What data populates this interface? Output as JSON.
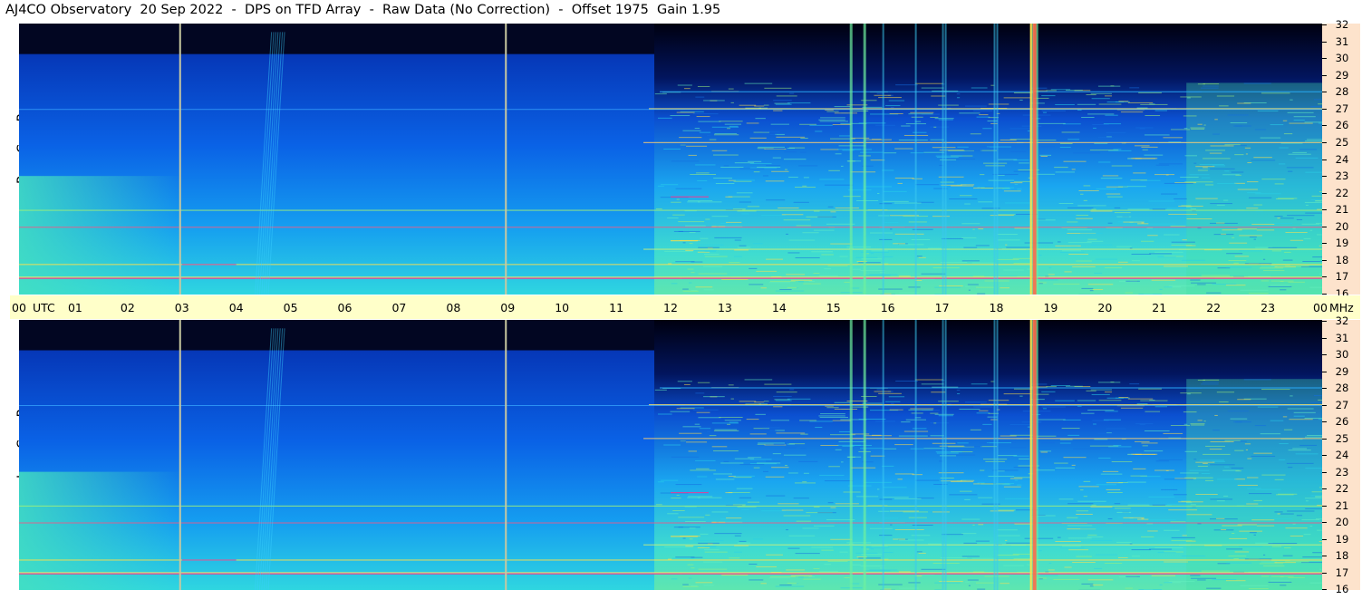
{
  "title": "AJ4CO Observatory  20 Sep 2022  -  DPS on TFD Array  -  Raw Data (No Correction)  -  Offset 1975  Gain 1.95",
  "panels": [
    {
      "id": "top",
      "polarization_letters": [
        "R",
        "C",
        "P"
      ]
    },
    {
      "id": "bot",
      "polarization_letters": [
        "L",
        "C",
        "P"
      ]
    }
  ],
  "time_axis": {
    "labels": [
      "00",
      "01",
      "02",
      "03",
      "04",
      "05",
      "06",
      "07",
      "08",
      "09",
      "10",
      "11",
      "12",
      "13",
      "14",
      "15",
      "16",
      "17",
      "18",
      "19",
      "20",
      "21",
      "22",
      "23",
      "00"
    ],
    "unit_label": "UTC",
    "freq_unit_label": "MHz"
  },
  "colors": {
    "time_bar": "#ffffc9",
    "freq_scale_bg": "#fde3cc",
    "marker_lines": "#c8c8a0"
  },
  "chart_data": {
    "type": "heatmap",
    "description_kind": "dynamic spectrogram",
    "x": {
      "label": "UTC",
      "range_hours": [
        0,
        24
      ],
      "ticks": [
        "00",
        "01",
        "02",
        "03",
        "04",
        "05",
        "06",
        "07",
        "08",
        "09",
        "10",
        "11",
        "12",
        "13",
        "14",
        "15",
        "16",
        "17",
        "18",
        "19",
        "20",
        "21",
        "22",
        "23",
        "00"
      ]
    },
    "y": {
      "label": "MHz",
      "range": [
        16,
        32
      ],
      "ticks": [
        16,
        17,
        18,
        19,
        20,
        21,
        22,
        23,
        24,
        25,
        26,
        27,
        28,
        29,
        30,
        31,
        32
      ]
    },
    "panels": [
      "R C P",
      "L C P"
    ],
    "vertical_marker_hours": [
      2.95,
      8.95
    ],
    "strong_interference_hours": [
      15.3,
      15.55,
      18.65,
      18.72
    ],
    "persistent_freq_lines_mhz": [
      17.0,
      17.8,
      18.7,
      20.0,
      21.0,
      25.0,
      27.0
    ]
  }
}
